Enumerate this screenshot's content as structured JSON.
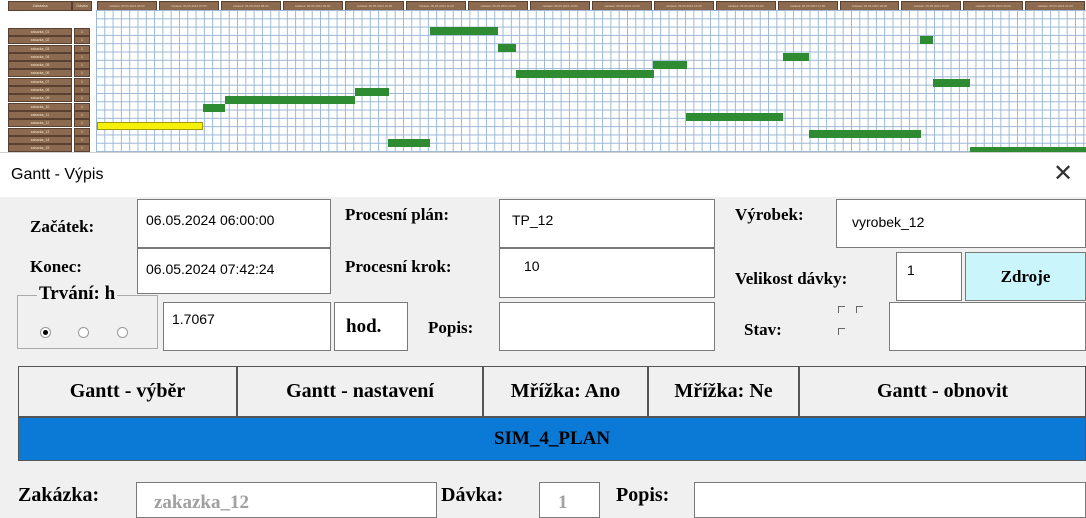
{
  "gantt": {
    "corner_headers": [
      "Zakázka",
      "Dávka"
    ],
    "date_headers": [
      "začátek: 06.05.2024 06:00",
      "začátek: 06.05.2024 07:00",
      "začátek: 06.05.2024 08:00",
      "začátek: 06.05.2024 09:00",
      "začátek: 06.05.2024 10:00",
      "začátek: 06.05.2024 11:00",
      "začátek: 06.05.2024 12:00",
      "začátek: 06.05.2024 13:00",
      "začátek: 06.05.2024 14:00",
      "začátek: 06.05.2024 15:00",
      "začátek: 06.05.2024 16:00",
      "začátek: 06.05.2024 17:00",
      "začátek: 06.05.2024 18:00",
      "začátek: 06.05.2024 19:00",
      "začátek: 06.05.2024 20:00",
      "začátek: 06.05.2024 21:00"
    ],
    "rows": [
      {
        "name": "zakazka_01",
        "davka": "1"
      },
      {
        "name": "zakazka_02",
        "davka": "1"
      },
      {
        "name": "zakazka_03",
        "davka": "1"
      },
      {
        "name": "zakazka_04",
        "davka": "1"
      },
      {
        "name": "zakazka_05",
        "davka": "1"
      },
      {
        "name": "zakazka_06",
        "davka": "1"
      },
      {
        "name": "zakazka_07",
        "davka": "1"
      },
      {
        "name": "zakazka_08",
        "davka": "1"
      },
      {
        "name": "zakazka_09",
        "davka": "1"
      },
      {
        "name": "zakazka_10",
        "davka": "1"
      },
      {
        "name": "zakazka_11",
        "davka": "1"
      },
      {
        "name": "zakazka_12",
        "davka": "1"
      },
      {
        "name": "zakazka_13",
        "davka": "1"
      },
      {
        "name": "zakazka_14",
        "davka": "1"
      },
      {
        "name": "zakazka_15",
        "davka": "1"
      }
    ],
    "colors": {
      "bar": "#2e8b32",
      "selected_bar": "#f6f00a",
      "header": "#8c6a50",
      "grid": "#9bb7d6"
    }
  },
  "dialog": {
    "title": "Gantt - Výpis",
    "close_icon": "close-icon",
    "zacatek_label": "Začátek:",
    "zacatek_value": "06.05.2024 06:00:00",
    "konec_label": "Konec:",
    "konec_value": "06.05.2024 07:42:24",
    "trvani_label": "Trvání: h",
    "trvani_value": "1.7067",
    "hod_label": "hod.",
    "procesni_plan_label": "Procesní plán:",
    "procesni_plan_value": "TP_12",
    "procesni_krok_label": "Procesní krok:",
    "procesni_krok_value": "10",
    "popis_label": "Popis:",
    "popis_value": "",
    "vyrobek_label": "Výrobek:",
    "vyrobek_value": "vyrobek_12",
    "velikost_davky_label": "Velikost dávky:",
    "velikost_davky_value": "1",
    "zdroje_label": "Zdroje",
    "stav_label": "Stav:",
    "stav_value": "",
    "buttons": {
      "gantt_vyber": "Gantt - výběr",
      "gantt_nastaveni": "Gantt - nastavení",
      "mrizka_ano": "Mřížka: Ano",
      "mrizka_ne": "Mřížka: Ne",
      "gantt_obnovit": "Gantt - obnovit"
    },
    "plan_name": "SIM_4_PLAN",
    "zakazka_label": "Zakázka:",
    "zakazka_value": "zakazka_12",
    "davka_label": "Dávka:",
    "davka_value": "1",
    "popis2_label": "Popis:",
    "popis2_value": "",
    "accent_color": "#0b7ad6",
    "zdroje_color": "#c9f5fb"
  }
}
